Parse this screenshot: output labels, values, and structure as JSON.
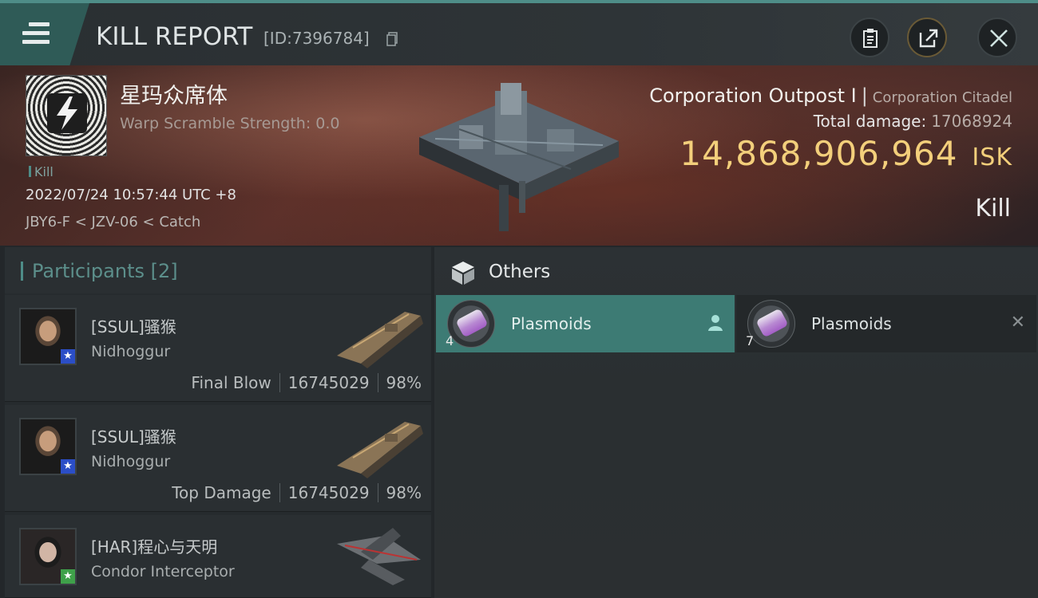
{
  "header": {
    "title": "KILL REPORT",
    "report_id": "[ID:7396784]",
    "icons": [
      "menu-icon",
      "copy-icon",
      "clipboard-icon",
      "share-icon",
      "close-icon"
    ]
  },
  "victim": {
    "name": "星玛众席体",
    "warp_scramble": "Warp Scramble Strength: 0.0",
    "tag": "Kill",
    "datetime": "2022/07/24 10:57:44 UTC +8",
    "location": "JBY6-F < JZV-06 < Catch",
    "ship": "Corporation Outpost I",
    "ship_class": "Corporation Citadel",
    "total_damage_label": "Total damage:",
    "total_damage": "17068924",
    "isk_value": "14,868,906,964",
    "isk_unit": "ISK",
    "result": "Kill"
  },
  "participants": {
    "title": "Participants [2]",
    "rows": [
      {
        "name": "[SSUL]骚猴",
        "ship": "Nidhoggur",
        "role": "Final Blow",
        "damage": "16745029",
        "percent": "98%"
      },
      {
        "name": "[SSUL]骚猴",
        "ship": "Nidhoggur",
        "role": "Top Damage",
        "damage": "16745029",
        "percent": "98%"
      },
      {
        "name": "[HAR]程心与天明",
        "ship": "Condor Interceptor"
      }
    ]
  },
  "others": {
    "title": "Others",
    "items": [
      {
        "name": "Plasmoids",
        "qty": "4",
        "state": "selected"
      },
      {
        "name": "Plasmoids",
        "qty": "7",
        "state": "destroyed"
      }
    ]
  },
  "colors": {
    "accent": "#4e8d88",
    "isk": "#f3cf7b",
    "selected_item": "#3d7b74"
  }
}
